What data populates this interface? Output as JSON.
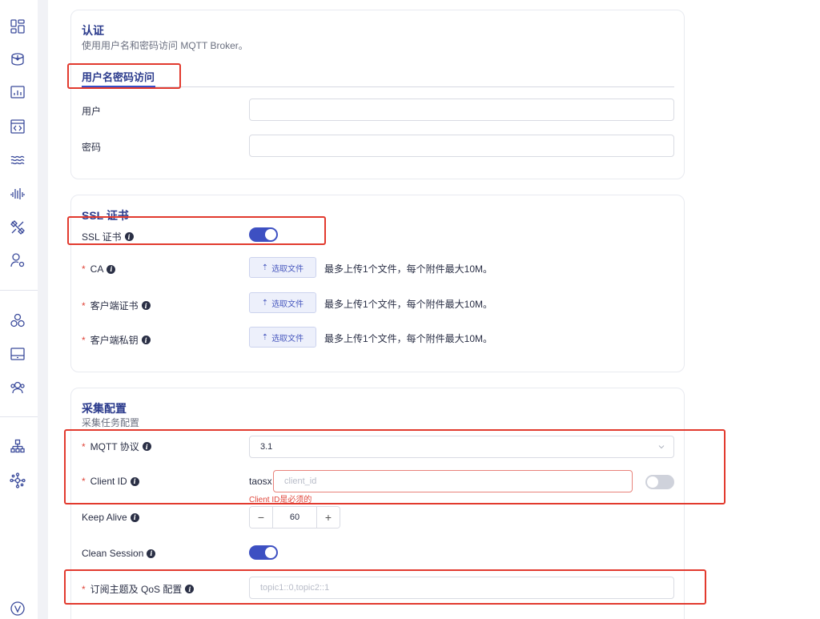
{
  "sidebar": {
    "items": [
      {
        "icon": "dashboard-icon"
      },
      {
        "icon": "data-in-icon"
      },
      {
        "icon": "chart-icon"
      },
      {
        "icon": "code-window-icon"
      },
      {
        "icon": "waves-icon"
      },
      {
        "icon": "stream-icon"
      },
      {
        "icon": "tools-icon"
      },
      {
        "icon": "user-settings-icon"
      },
      {
        "icon": "cluster-icon"
      },
      {
        "icon": "panel-icon"
      },
      {
        "icon": "users-icon"
      },
      {
        "icon": "org-tree-icon"
      },
      {
        "icon": "network-icon"
      },
      {
        "icon": "version-icon"
      }
    ]
  },
  "auth": {
    "title": "认证",
    "desc": "使用用户名和密码访问 MQTT Broker。",
    "tab_label": "用户名密码访问",
    "user_label": "用户",
    "user_value": "",
    "password_label": "密码",
    "password_value": ""
  },
  "ssl": {
    "title": "SSL 证书",
    "toggle_label": "SSL 证书",
    "toggle_on": true,
    "upload_button": "选取文件",
    "upload_hint": "最多上传1个文件，每个附件最大10M。",
    "ca_label": "CA",
    "client_cert_label": "客户端证书",
    "client_key_label": "客户端私钥"
  },
  "collect": {
    "title": "采集配置",
    "desc": "采集任务配置",
    "mqtt_protocol_label": "MQTT 协议",
    "mqtt_protocol_value": "3.1",
    "client_id_label": "Client ID",
    "client_id_prefix": "taosx",
    "client_id_placeholder": "client_id",
    "client_id_error": "Client ID是必须的",
    "client_id_toggle_on": false,
    "keep_alive_label": "Keep Alive",
    "keep_alive_value": "60",
    "clean_session_label": "Clean Session",
    "clean_session_on": true,
    "topics_label": "订阅主题及 QoS 配置",
    "topics_placeholder": "topic1::0,topic2::1"
  },
  "colors": {
    "accent": "#3d50c2",
    "title": "#2a3a8c",
    "error": "#e0473c",
    "highlight_box": "#e23a2e"
  }
}
